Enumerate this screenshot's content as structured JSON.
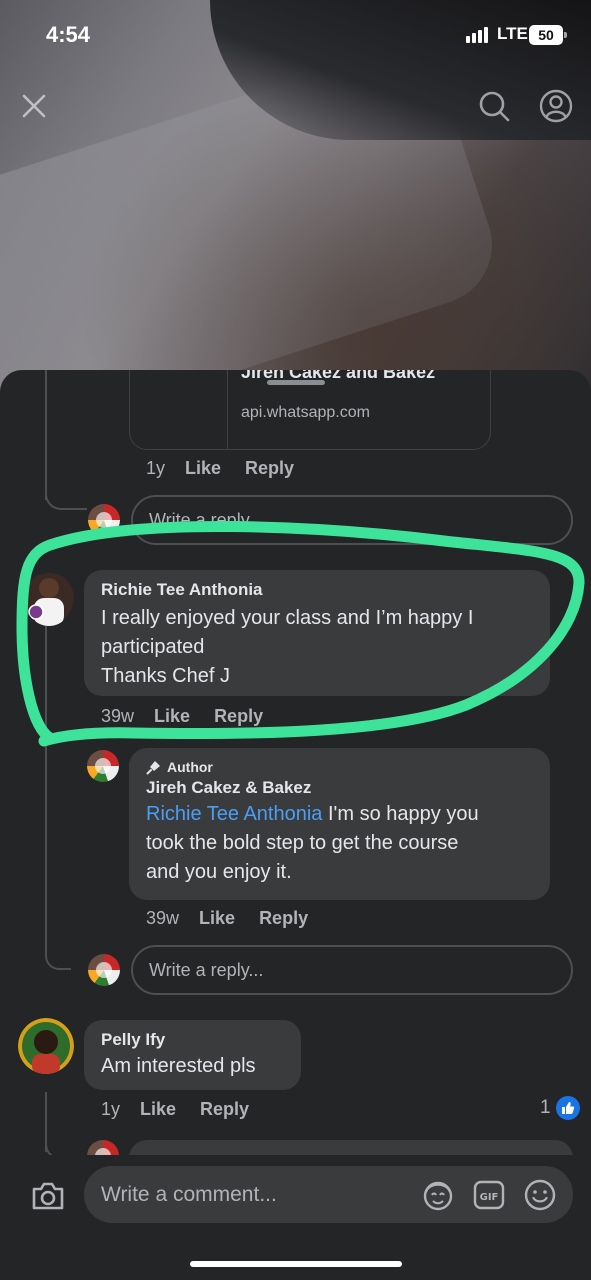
{
  "status_bar": {
    "time": "4:54",
    "network": "LTE",
    "battery": "50"
  },
  "icons": {
    "close": "close-icon",
    "search": "search-icon",
    "profile": "profile-icon",
    "camera": "camera-icon",
    "avatar_sticker": "avatar-sticker-icon",
    "gif": "gif-icon",
    "emoji": "emoji-icon"
  },
  "link_preview": {
    "title": "Jireh Cakez and Bakez",
    "domain": "api.whatsapp.com"
  },
  "first_reply_meta": {
    "time": "1y",
    "like": "Like",
    "reply": "Reply"
  },
  "reply_placeholder": "Write a reply...",
  "comments": [
    {
      "name": "Richie Tee Anthonia",
      "text": "I really enjoyed your class and I’m happy I participated\nThanks Chef J",
      "line1": "I really enjoyed your class and I’m happy I",
      "line2": "participated",
      "line3": "Thanks Chef J",
      "time": "39w",
      "like": "Like",
      "reply": "Reply",
      "replies": [
        {
          "badge": "Author",
          "name": "Jireh Cakez & Bakez",
          "mention": "Richie Tee Anthonia",
          "line1": " I'm so happy you",
          "line2": "took the bold step to get the course",
          "line3": "and you enjoy it.",
          "time": "39w",
          "like": "Like",
          "reply": "Reply"
        }
      ]
    },
    {
      "name": "Pelly Ify",
      "text": "Am interested pls",
      "time": "1y",
      "like": "Like",
      "reply": "Reply",
      "reaction_count": "1"
    }
  ],
  "composer": {
    "placeholder": "Write a comment..."
  },
  "colors": {
    "sheet_bg": "#242526",
    "bubble_bg": "#3a3b3c",
    "mention": "#4b9ef5",
    "highlight": "#3ee39a",
    "like_blue": "#1b74e4"
  }
}
